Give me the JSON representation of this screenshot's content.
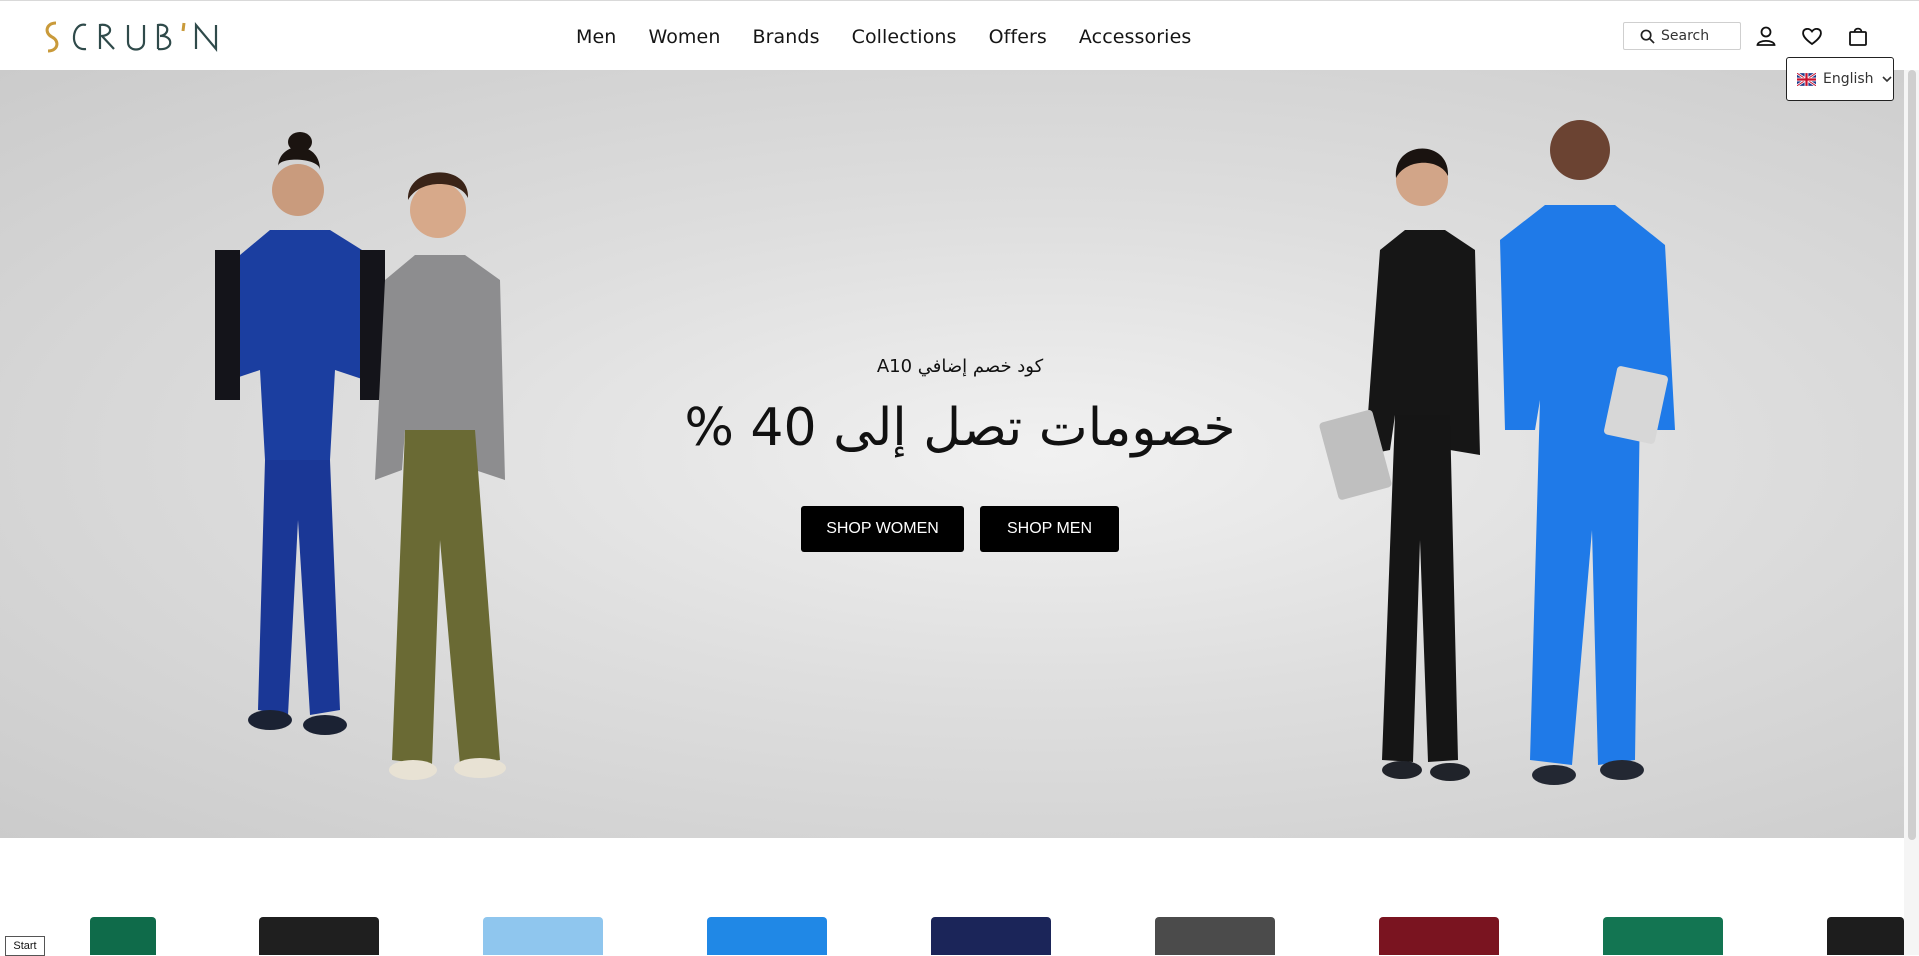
{
  "brand": {
    "logo_text": "SCRUB'N"
  },
  "nav": {
    "items": [
      "Men",
      "Women",
      "Brands",
      "Collections",
      "Offers",
      "Accessories"
    ]
  },
  "header": {
    "search_label": "Search",
    "language": "English"
  },
  "hero": {
    "subtitle": "كود خصم إضافي A10",
    "title": "خصومات تصل إلى 40 %",
    "shop_women": "SHOP WOMEN",
    "shop_men": "SHOP MEN"
  },
  "taskbar": {
    "start_label": "Start"
  },
  "icons": [
    "search-icon",
    "account-icon",
    "wishlist-heart-icon",
    "shopping-bag-icon",
    "uk-flag-icon",
    "chevron-down-icon"
  ]
}
